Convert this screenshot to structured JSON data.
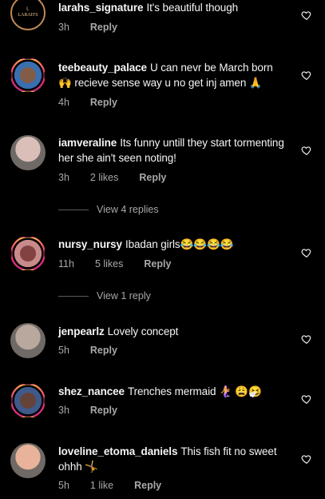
{
  "comments": [
    {
      "user": "larahs_signature",
      "text": "It's beautiful though",
      "time": "3h",
      "likes": "",
      "reply": "Reply",
      "avatar_logo": "LARAH'S"
    },
    {
      "user": "teebeauty_palace",
      "text": "U can nevr be March born 🙌 recieve sense way u no get inj amen 🙏",
      "time": "4h",
      "likes": "",
      "reply": "Reply"
    },
    {
      "user": "iamveraline",
      "text": "Its funny untill they start tormenting her she ain't seen noting!",
      "time": "3h",
      "likes": "2 likes",
      "reply": "Reply",
      "view_replies": "View 4 replies"
    },
    {
      "user": "nursy_nursy",
      "text": "Ibadan girls😂😂😂😂",
      "time": "11h",
      "likes": "5 likes",
      "reply": "Reply",
      "view_replies": "View 1 reply"
    },
    {
      "user": "jenpearlz",
      "text": "Lovely concept",
      "time": "5h",
      "likes": "",
      "reply": "Reply"
    },
    {
      "user": "shez_nancee",
      "text": "Trenches mermaid 🧜‍♀️ 😩🤧",
      "time": "3h",
      "likes": "",
      "reply": "Reply"
    },
    {
      "user": "loveline_etoma_daniels",
      "text": "This fish fit no sweet ohhh 🤸",
      "time": "5h",
      "likes": "1 like",
      "reply": "Reply"
    }
  ],
  "icons": {
    "like": "heart-outline-icon"
  },
  "colors": {
    "background": "#000000",
    "text": "#f5f5f5",
    "muted": "#a8a8a8"
  }
}
